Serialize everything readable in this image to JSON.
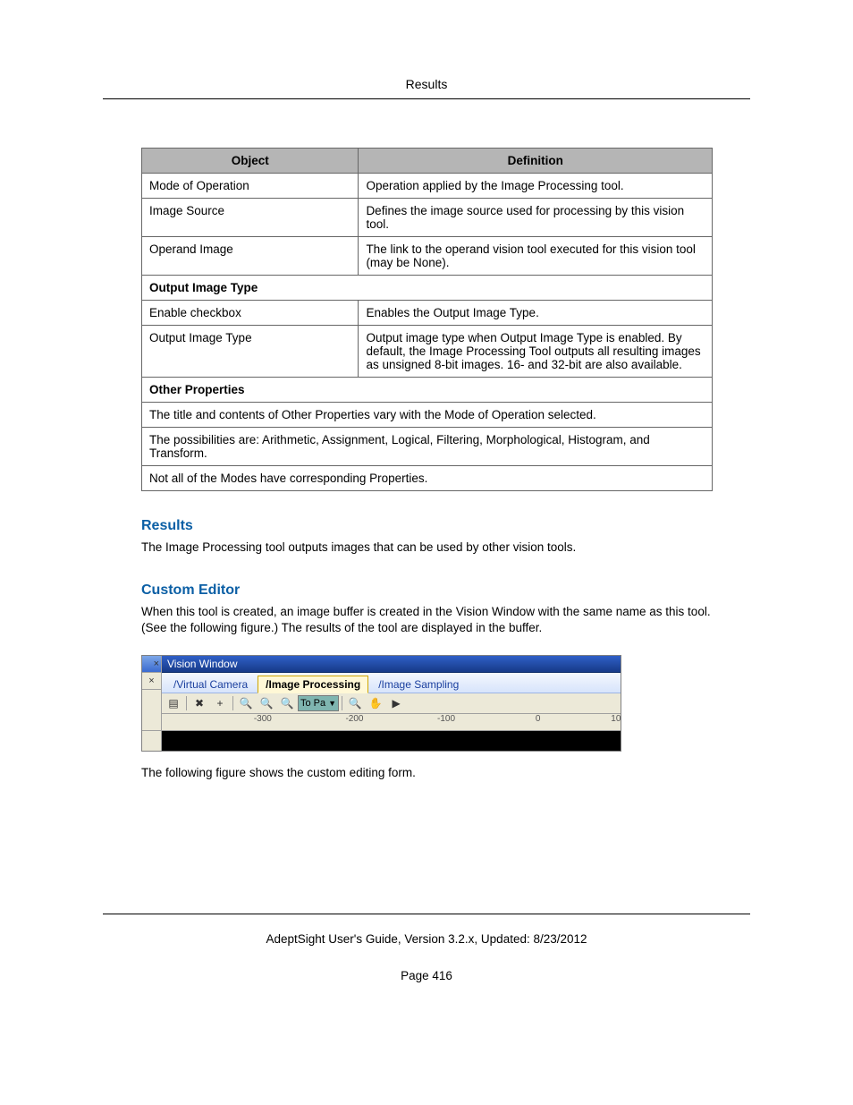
{
  "header": {
    "title": "Results"
  },
  "table": {
    "headers": {
      "object": "Object",
      "definition": "Definition"
    },
    "rows": [
      {
        "object": "Mode of Operation",
        "definition": "Operation applied by the Image Processing tool."
      },
      {
        "object": "Image Source",
        "definition": "Defines the image source used for processing by this vision tool."
      },
      {
        "object": "Operand Image",
        "definition": "The link to the operand vision tool executed for this vision tool (may be None)."
      }
    ],
    "section1": "Output Image Type",
    "rows2": [
      {
        "object": "Enable checkbox",
        "definition": "Enables the Output Image Type."
      },
      {
        "object": "Output Image Type",
        "definition": "Output image type when Output Image Type is enabled. By default, the Image Processing Tool outputs all resulting images as unsigned 8-bit images. 16- and 32-bit are also available."
      }
    ],
    "section2": "Other Properties",
    "notes": [
      "The title and contents of Other Properties vary with the Mode of Operation selected.",
      "The possibilities are: Arithmetic, Assignment, Logical, Filtering, Morphological, Histogram, and Transform.",
      "Not all of the Modes have corresponding Properties."
    ]
  },
  "sections": {
    "results": {
      "heading": "Results",
      "body": "The Image Processing tool outputs images that can be used by other vision tools."
    },
    "custom_editor": {
      "heading": "Custom Editor",
      "body": "When this tool is created, an image buffer is created in the Vision Window with the same name as this tool. (See the following figure.) The results of the tool are displayed in the buffer."
    }
  },
  "vision_window": {
    "title": "Vision Window",
    "tabs": [
      "/Virtual Camera",
      "/Image Processing",
      "/Image Sampling"
    ],
    "active_tab_index": 1,
    "toolbar_combo": "To Pa",
    "ruler": [
      {
        "label": "-300",
        "left_pct": 22
      },
      {
        "label": "-200",
        "left_pct": 42
      },
      {
        "label": "-100",
        "left_pct": 62
      },
      {
        "label": "0",
        "left_pct": 82
      },
      {
        "label": "10",
        "left_pct": 99
      }
    ]
  },
  "caption": "The following figure shows the custom editing form.",
  "footer": {
    "line": "AdeptSight User's Guide,  Version 3.2.x, Updated: 8/23/2012",
    "page": "Page 416"
  }
}
